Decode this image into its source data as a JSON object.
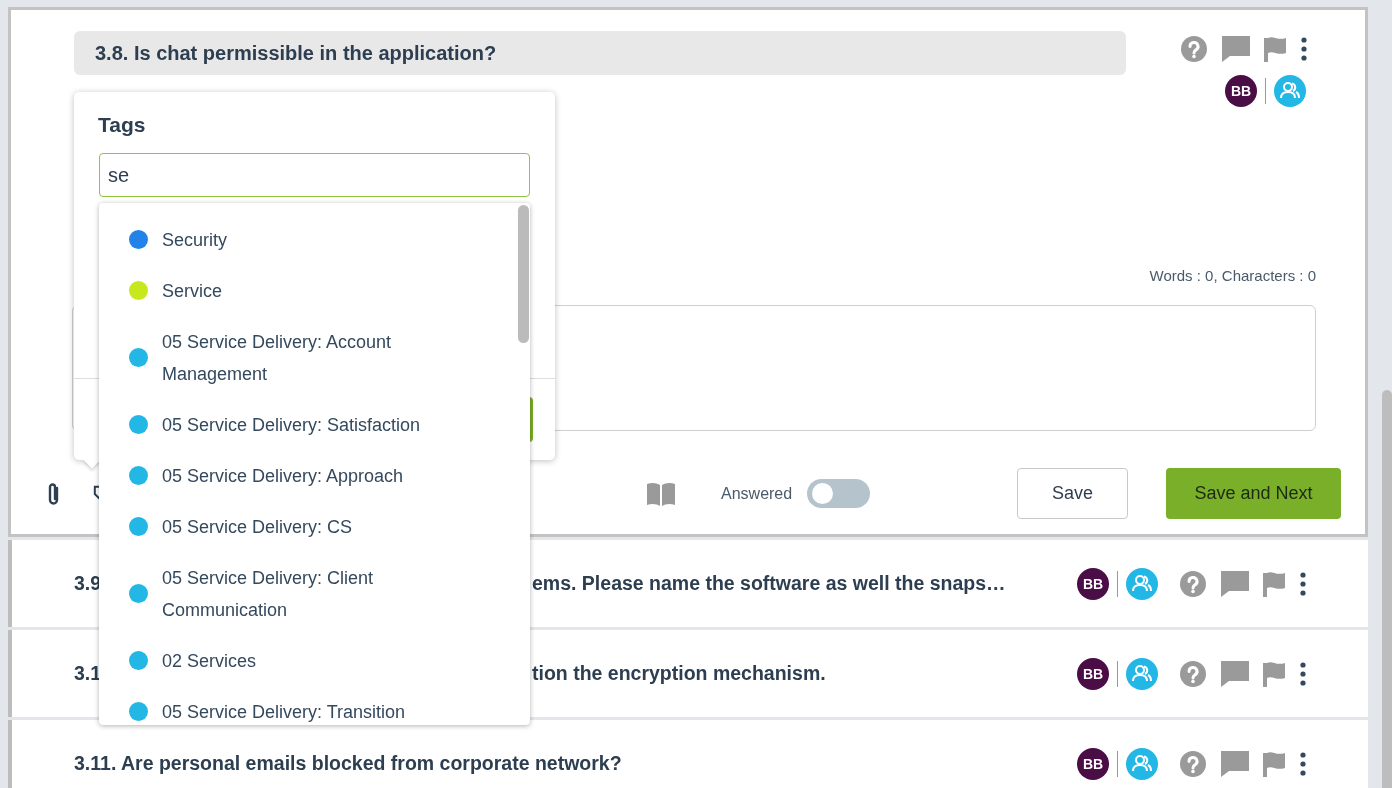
{
  "question": {
    "title": "3.8. Is chat permissible in the application?",
    "avatar": "BB",
    "counter": "Words : 0, Characters : 0",
    "answered_label": "Answered",
    "answered": false,
    "buttons": [
      {
        "label": "Save",
        "kind": "secondary"
      },
      {
        "label": "Save and Next",
        "kind": "primary"
      }
    ]
  },
  "tags_popover": {
    "title": "Tags",
    "search_value": "se",
    "items": [
      {
        "label": "Security",
        "color": "#2183e8"
      },
      {
        "label": "Service",
        "color": "#c8e81e"
      },
      {
        "label": "05 Service Delivery: Account Management",
        "color": "#23b7e5"
      },
      {
        "label": "05 Service Delivery: Satisfaction",
        "color": "#23b7e5"
      },
      {
        "label": "05 Service Delivery: Approach",
        "color": "#23b7e5"
      },
      {
        "label": "05 Service Delivery: CS",
        "color": "#23b7e5"
      },
      {
        "label": "05 Service Delivery: Client Communication",
        "color": "#23b7e5"
      },
      {
        "label": "02 Services",
        "color": "#23b7e5"
      },
      {
        "label": "05 Service Delivery: Transition",
        "color": "#23b7e5"
      }
    ]
  },
  "questions": [
    {
      "title_start": "3.9",
      "title_end": "ems. Please name the software as well the snaps…",
      "avatar": "BB"
    },
    {
      "title_start": "3.1",
      "title_end": "tion the encryption mechanism.",
      "avatar": "BB"
    },
    {
      "title": "3.11. Are personal emails blocked from corporate network?",
      "avatar": "BB"
    }
  ]
}
